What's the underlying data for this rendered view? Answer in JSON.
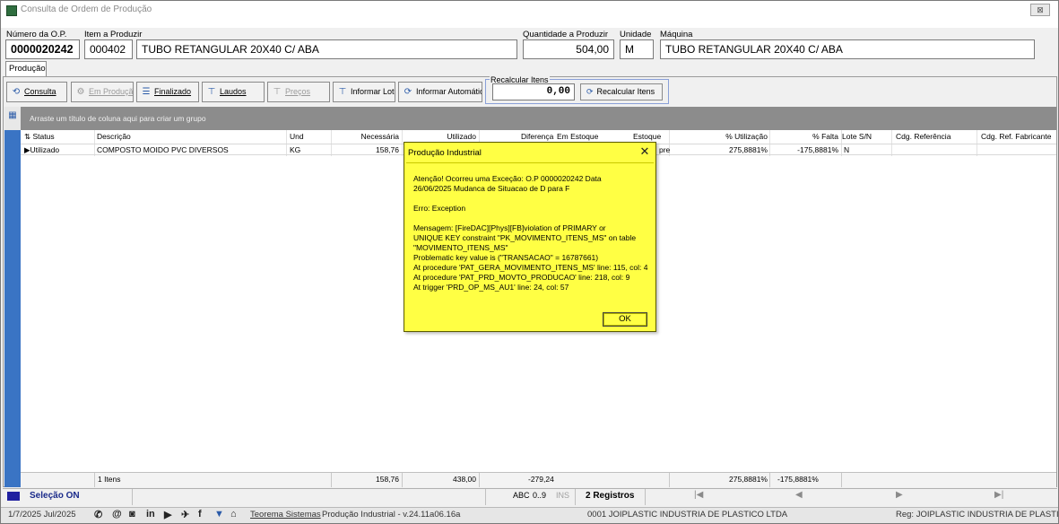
{
  "window": {
    "title": "Consulta de Ordem de Produção",
    "close_label": "⊠"
  },
  "form": {
    "numero_op_label": "Número da O.P.",
    "numero_op_value": "0000020242",
    "item_label": "Item a Produzir",
    "item_code": "000402",
    "item_desc": "TUBO RETANGULAR 20X40 C/ ABA",
    "quantidade_label": "Quantidade a Produzir",
    "quantidade_value": "504,00",
    "unidade_label": "Unidade",
    "unidade_value": "M",
    "maquina_label": "Máquina",
    "maquina_value": "TUBO RETANGULAR 20X40 C/ ABA"
  },
  "tab": {
    "label": "Produção"
  },
  "toolbar": {
    "consulta": "Consulta",
    "em_producao": "Em Produção",
    "finalizado": "Finalizado",
    "laudos": "Laudos",
    "precos": "Preços",
    "informar_lotes": "Informar Lotes",
    "informar_automatico": "Informar Automático",
    "recalcular_legend": "Recalcular Itens",
    "recalcular_value": "0,00",
    "recalcular_button": "Recalcular Itens"
  },
  "grid": {
    "group_hint": "Arraste um título de coluna aqui para criar um grupo",
    "headers": {
      "status": "Status",
      "descricao": "Descrição",
      "und": "Und",
      "necessaria": "Necessária",
      "utilizado": "Utilizado",
      "diferenca": "Diferença",
      "em_estoque": "Em Estoque",
      "estoque": "Estoque",
      "utilizacao": "% Utilização",
      "falta": "% Falta",
      "lote": "Lote S/N",
      "cdg_ref": "Cdg. Referência",
      "cdg_ref_fab": "Cdg. Ref. Fabricante"
    },
    "rows": [
      {
        "status": "Utilizado",
        "descricao": "COMPOSTO MOIDO PVC DIVERSOS",
        "und": "KG",
        "necessaria": "158,76",
        "estoque_tail": "pre",
        "utilizacao": "275,8881%",
        "falta": "-175,8881%",
        "lote": "N"
      }
    ],
    "footer": {
      "itens": "1 Itens",
      "necessaria": "158,76",
      "utilizado": "438,00",
      "diferenca": "-279,24",
      "utilizacao": "275,8881%",
      "falta": "-175,8881%"
    }
  },
  "navbar": {
    "selecao": "Seleção ON",
    "abc": "ABC",
    "range": "0..9",
    "ins": "INS",
    "registros": "2 Registros",
    "first": "|◀",
    "prev": "◀",
    "next": "▶",
    "last": "▶|"
  },
  "statusbar": {
    "date": "1/7/2025 Jul/2025",
    "teorema": "Teorema Sistemas",
    "version": "Produção Industrial - v.24.11a06.16a",
    "company": "0001 JOIPLASTIC INDUSTRIA DE PLASTICO LTDA",
    "reg": "Reg: JOIPLASTIC INDUSTRIA DE PLASTICO"
  },
  "dialog": {
    "title": "Produção Industrial",
    "close": "✕",
    "lines": [
      "Atenção! Ocorreu uma Exceção:  O.P 0000020242 Data",
      "26/06/2025 Mudanca de Situacao de D para F",
      "",
      "Erro: Exception",
      "",
      " Mensagem: [FireDAC][Phys][FB]violation of PRIMARY or",
      "UNIQUE KEY constraint \"PK_MOVIMENTO_ITENS_MS\" on table",
      "\"MOVIMENTO_ITENS_MS\"",
      "Problematic key value is (\"TRANSACAO\" = 16787661)",
      "At procedure 'PAT_GERA_MOVIMENTO_ITENS_MS' line: 115, col: 4",
      "At procedure 'PAT_PRD_MOVTO_PRODUCAO' line: 218, col: 9",
      "At trigger 'PRD_OP_MS_AU1' line: 24, col: 57"
    ],
    "ok": "OK"
  },
  "colors": {
    "dialog_bg": "#ffff44",
    "grid_group_bar": "#8c8c8c",
    "left_strip": "#3a74c4"
  }
}
